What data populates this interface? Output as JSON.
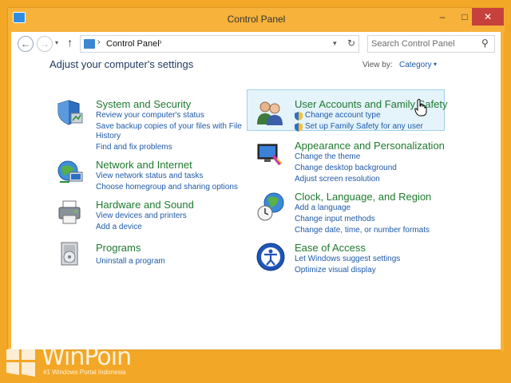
{
  "window": {
    "title": "Control Panel"
  },
  "window_controls": {
    "minimize": "–",
    "maximize": "□",
    "close": "✕"
  },
  "nav": {
    "back": "←",
    "forward": "→",
    "recent": "▾",
    "up": "↑",
    "address": "Control Panel",
    "separator": "›",
    "dropdown": "▾",
    "refresh": "↻",
    "search_placeholder": "Search Control Panel",
    "search_icon": "⚲"
  },
  "main": {
    "heading": "Adjust your computer's settings",
    "view_by_label": "View by:",
    "view_by_value": "Category",
    "view_by_caret": "▾"
  },
  "categories": [
    {
      "title": "System and Security",
      "links": [
        "Review your computer's status",
        "Save backup copies of your files with File",
        "History",
        "Find and fix problems"
      ],
      "icon": "shield-icon"
    },
    {
      "title": "Network and Internet",
      "links": [
        "View network status and tasks",
        "Choose homegroup and sharing options"
      ],
      "icon": "network-icon"
    },
    {
      "title": "Hardware and Sound",
      "links": [
        "View devices and printers",
        "Add a device"
      ],
      "icon": "printer-icon"
    },
    {
      "title": "Programs",
      "links": [
        "Uninstall a program"
      ],
      "icon": "programs-icon"
    },
    {
      "title": "User Accounts and Family Safety",
      "links": [
        "Change account type",
        "Set up Family Safety for any user"
      ],
      "icon": "users-icon"
    },
    {
      "title": "Appearance and Personalization",
      "links": [
        "Change the theme",
        "Change desktop background",
        "Adjust screen resolution"
      ],
      "icon": "display-icon"
    },
    {
      "title": "Clock, Language, and Region",
      "links": [
        "Add a language",
        "Change input methods",
        "Change date, time, or number formats"
      ],
      "icon": "globe-clock-icon"
    },
    {
      "title": "Ease of Access",
      "links": [
        "Let Windows suggest settings",
        "Optimize visual display"
      ],
      "icon": "ease-of-access-icon"
    }
  ],
  "watermark": {
    "title": "WinPoin",
    "subtitle": "#1 Windows Portal Indonesia"
  },
  "colors": {
    "desktop": "#f2a726",
    "frame": "#f6b23a",
    "link": "#1e5aa8",
    "category_title": "#1e7a2e",
    "close": "#c7413c"
  }
}
